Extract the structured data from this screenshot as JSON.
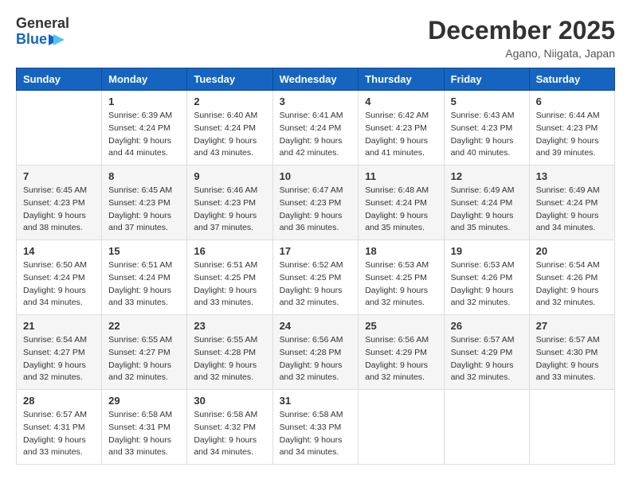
{
  "header": {
    "logo_general": "General",
    "logo_blue": "Blue",
    "month": "December 2025",
    "location": "Agano, Niigata, Japan"
  },
  "days_of_week": [
    "Sunday",
    "Monday",
    "Tuesday",
    "Wednesday",
    "Thursday",
    "Friday",
    "Saturday"
  ],
  "weeks": [
    [
      {
        "day": "",
        "info": ""
      },
      {
        "day": "1",
        "info": "Sunrise: 6:39 AM\nSunset: 4:24 PM\nDaylight: 9 hours\nand 44 minutes."
      },
      {
        "day": "2",
        "info": "Sunrise: 6:40 AM\nSunset: 4:24 PM\nDaylight: 9 hours\nand 43 minutes."
      },
      {
        "day": "3",
        "info": "Sunrise: 6:41 AM\nSunset: 4:24 PM\nDaylight: 9 hours\nand 42 minutes."
      },
      {
        "day": "4",
        "info": "Sunrise: 6:42 AM\nSunset: 4:23 PM\nDaylight: 9 hours\nand 41 minutes."
      },
      {
        "day": "5",
        "info": "Sunrise: 6:43 AM\nSunset: 4:23 PM\nDaylight: 9 hours\nand 40 minutes."
      },
      {
        "day": "6",
        "info": "Sunrise: 6:44 AM\nSunset: 4:23 PM\nDaylight: 9 hours\nand 39 minutes."
      }
    ],
    [
      {
        "day": "7",
        "info": "Sunrise: 6:45 AM\nSunset: 4:23 PM\nDaylight: 9 hours\nand 38 minutes."
      },
      {
        "day": "8",
        "info": "Sunrise: 6:45 AM\nSunset: 4:23 PM\nDaylight: 9 hours\nand 37 minutes."
      },
      {
        "day": "9",
        "info": "Sunrise: 6:46 AM\nSunset: 4:23 PM\nDaylight: 9 hours\nand 37 minutes."
      },
      {
        "day": "10",
        "info": "Sunrise: 6:47 AM\nSunset: 4:23 PM\nDaylight: 9 hours\nand 36 minutes."
      },
      {
        "day": "11",
        "info": "Sunrise: 6:48 AM\nSunset: 4:24 PM\nDaylight: 9 hours\nand 35 minutes."
      },
      {
        "day": "12",
        "info": "Sunrise: 6:49 AM\nSunset: 4:24 PM\nDaylight: 9 hours\nand 35 minutes."
      },
      {
        "day": "13",
        "info": "Sunrise: 6:49 AM\nSunset: 4:24 PM\nDaylight: 9 hours\nand 34 minutes."
      }
    ],
    [
      {
        "day": "14",
        "info": "Sunrise: 6:50 AM\nSunset: 4:24 PM\nDaylight: 9 hours\nand 34 minutes."
      },
      {
        "day": "15",
        "info": "Sunrise: 6:51 AM\nSunset: 4:24 PM\nDaylight: 9 hours\nand 33 minutes."
      },
      {
        "day": "16",
        "info": "Sunrise: 6:51 AM\nSunset: 4:25 PM\nDaylight: 9 hours\nand 33 minutes."
      },
      {
        "day": "17",
        "info": "Sunrise: 6:52 AM\nSunset: 4:25 PM\nDaylight: 9 hours\nand 32 minutes."
      },
      {
        "day": "18",
        "info": "Sunrise: 6:53 AM\nSunset: 4:25 PM\nDaylight: 9 hours\nand 32 minutes."
      },
      {
        "day": "19",
        "info": "Sunrise: 6:53 AM\nSunset: 4:26 PM\nDaylight: 9 hours\nand 32 minutes."
      },
      {
        "day": "20",
        "info": "Sunrise: 6:54 AM\nSunset: 4:26 PM\nDaylight: 9 hours\nand 32 minutes."
      }
    ],
    [
      {
        "day": "21",
        "info": "Sunrise: 6:54 AM\nSunset: 4:27 PM\nDaylight: 9 hours\nand 32 minutes."
      },
      {
        "day": "22",
        "info": "Sunrise: 6:55 AM\nSunset: 4:27 PM\nDaylight: 9 hours\nand 32 minutes."
      },
      {
        "day": "23",
        "info": "Sunrise: 6:55 AM\nSunset: 4:28 PM\nDaylight: 9 hours\nand 32 minutes."
      },
      {
        "day": "24",
        "info": "Sunrise: 6:56 AM\nSunset: 4:28 PM\nDaylight: 9 hours\nand 32 minutes."
      },
      {
        "day": "25",
        "info": "Sunrise: 6:56 AM\nSunset: 4:29 PM\nDaylight: 9 hours\nand 32 minutes."
      },
      {
        "day": "26",
        "info": "Sunrise: 6:57 AM\nSunset: 4:29 PM\nDaylight: 9 hours\nand 32 minutes."
      },
      {
        "day": "27",
        "info": "Sunrise: 6:57 AM\nSunset: 4:30 PM\nDaylight: 9 hours\nand 33 minutes."
      }
    ],
    [
      {
        "day": "28",
        "info": "Sunrise: 6:57 AM\nSunset: 4:31 PM\nDaylight: 9 hours\nand 33 minutes."
      },
      {
        "day": "29",
        "info": "Sunrise: 6:58 AM\nSunset: 4:31 PM\nDaylight: 9 hours\nand 33 minutes."
      },
      {
        "day": "30",
        "info": "Sunrise: 6:58 AM\nSunset: 4:32 PM\nDaylight: 9 hours\nand 34 minutes."
      },
      {
        "day": "31",
        "info": "Sunrise: 6:58 AM\nSunset: 4:33 PM\nDaylight: 9 hours\nand 34 minutes."
      },
      {
        "day": "",
        "info": ""
      },
      {
        "day": "",
        "info": ""
      },
      {
        "day": "",
        "info": ""
      }
    ]
  ]
}
